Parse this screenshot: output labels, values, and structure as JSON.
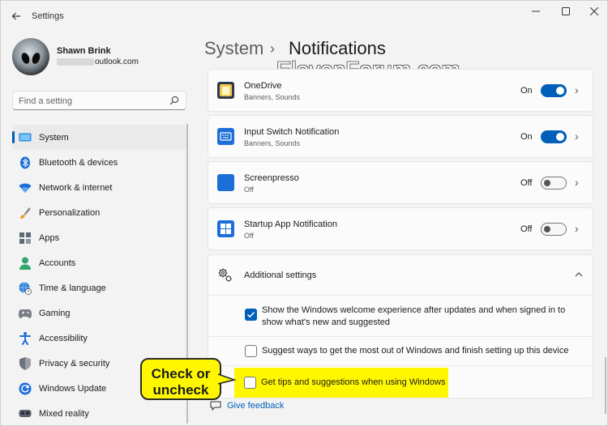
{
  "window": {
    "title": "Settings"
  },
  "profile": {
    "name": "Shawn Brink",
    "email_suffix": "outlook.com"
  },
  "search": {
    "placeholder": "Find a setting"
  },
  "nav": {
    "items": [
      {
        "label": "System",
        "icon": "system-icon",
        "active": true
      },
      {
        "label": "Bluetooth & devices",
        "icon": "bluetooth-icon"
      },
      {
        "label": "Network & internet",
        "icon": "wifi-icon"
      },
      {
        "label": "Personalization",
        "icon": "brush-icon"
      },
      {
        "label": "Apps",
        "icon": "apps-icon"
      },
      {
        "label": "Accounts",
        "icon": "accounts-icon"
      },
      {
        "label": "Time & language",
        "icon": "globe-clock-icon"
      },
      {
        "label": "Gaming",
        "icon": "gamepad-icon"
      },
      {
        "label": "Accessibility",
        "icon": "accessibility-icon"
      },
      {
        "label": "Privacy & security",
        "icon": "shield-icon"
      },
      {
        "label": "Windows Update",
        "icon": "update-icon"
      },
      {
        "label": "Mixed reality",
        "icon": "headset-icon"
      }
    ]
  },
  "breadcrumb": {
    "parent": "System",
    "separator": "›",
    "current": "Notifications"
  },
  "watermark": "ElevenForum.com",
  "apps": [
    {
      "title": "OneDrive",
      "subtitle": "Banners, Sounds",
      "state": "On",
      "icon": "onedrive-icon"
    },
    {
      "title": "Input Switch Notification",
      "subtitle": "Banners, Sounds",
      "state": "On",
      "icon": "input-switch-icon"
    },
    {
      "title": "Screenpresso",
      "subtitle": "Off",
      "state": "Off",
      "icon": "screenpresso-icon"
    },
    {
      "title": "Startup App Notification",
      "subtitle": "Off",
      "state": "Off",
      "icon": "startup-app-icon"
    }
  ],
  "additional": {
    "title": "Additional settings",
    "options": [
      {
        "text": "Show the Windows welcome experience after updates and when signed in to show what's new and suggested",
        "checked": true
      },
      {
        "text": "Suggest ways to get the most out of Windows and finish setting up this device",
        "checked": false
      },
      {
        "text": "Get tips and suggestions when using Windows",
        "checked": false
      }
    ]
  },
  "feedback": {
    "label": "Give feedback"
  },
  "callout": {
    "line1": "Check or",
    "line2": "uncheck"
  },
  "colors": {
    "accent": "#005fb8",
    "highlight": "#fff700"
  }
}
